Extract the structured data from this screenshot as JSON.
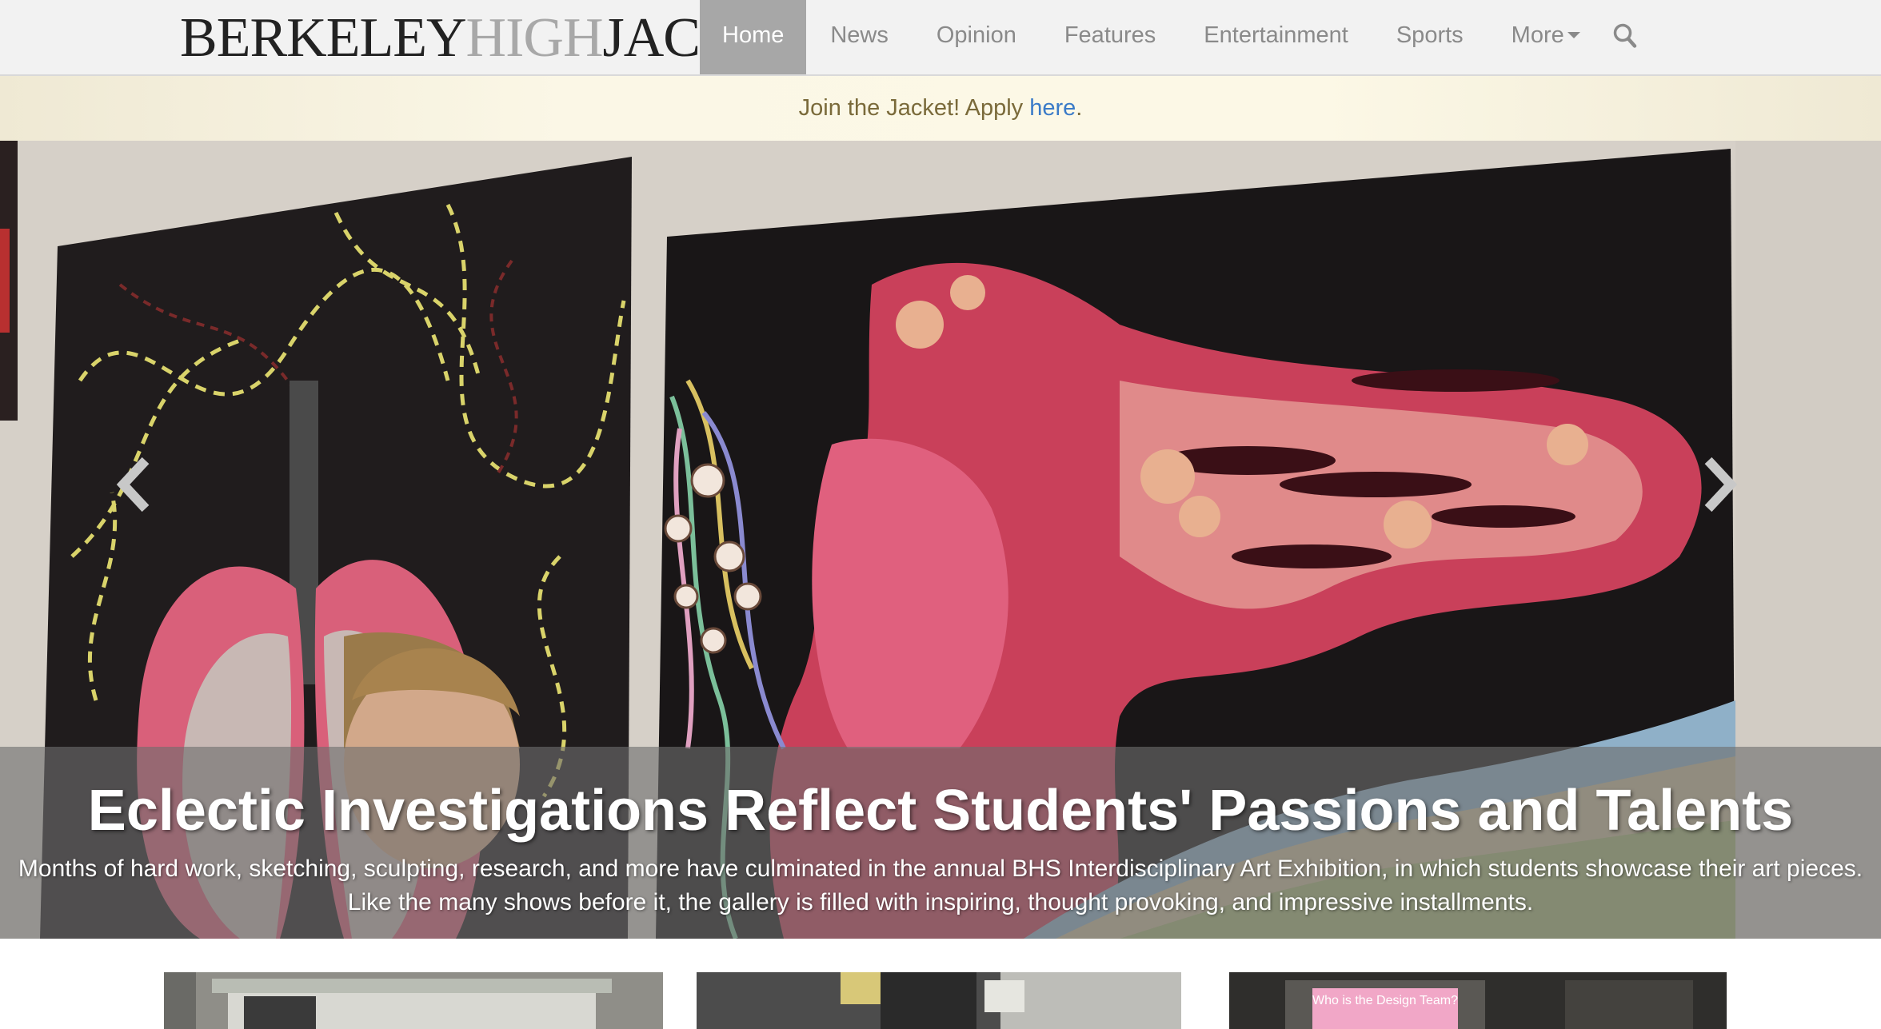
{
  "brand": {
    "part1": "BERKELEY",
    "part2": "HIGH",
    "part3": "JACKET"
  },
  "nav": {
    "items": [
      {
        "label": "Home",
        "active": true
      },
      {
        "label": "News"
      },
      {
        "label": "Opinion"
      },
      {
        "label": "Features"
      },
      {
        "label": "Entertainment"
      },
      {
        "label": "Sports"
      },
      {
        "label": "More"
      }
    ],
    "search_icon": "search-icon"
  },
  "announcement": {
    "text": "Join the Jacket! Apply ",
    "link": "here",
    "suffix": "."
  },
  "hero": {
    "title": "Eclectic Investigations Reflect Students' Passions and Talents",
    "summary_line1": "Months of hard work, sketching, sculpting, research, and more have culminated in the annual BHS Interdisciplinary Art Exhibition, in which students showcase their art pieces.",
    "summary_line2": "Like the many shows before it, the gallery is filled with inspiring, thought provoking, and impressive installments.",
    "prev_icon": "chevron-left-icon",
    "next_icon": "chevron-right-icon"
  },
  "thumbnails": [
    {
      "slide_text": ""
    },
    {
      "slide_text": ""
    },
    {
      "slide_text": "Who is the Design Team?"
    }
  ],
  "colors": {
    "nav_active": "#a7a7a7",
    "link": "#3a7bc8",
    "announce_text": "#7a6a3a"
  }
}
